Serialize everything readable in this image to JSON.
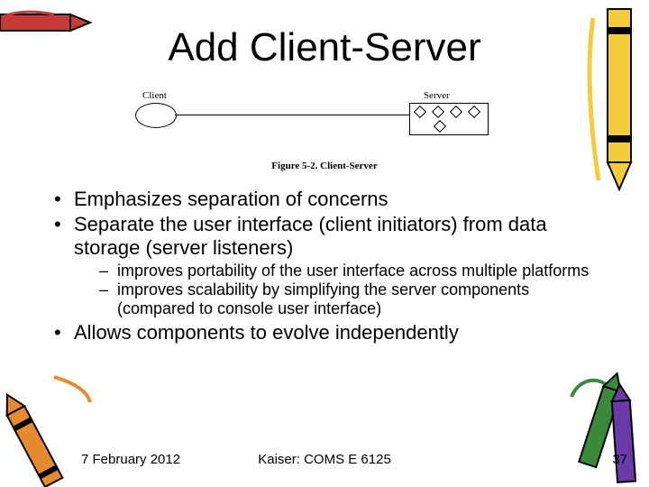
{
  "title": "Add Client-Server",
  "diagram": {
    "client_label": "Client",
    "server_label": "Server",
    "caption": "Figure 5-2. Client-Server"
  },
  "bullets": {
    "b1": "Emphasizes separation of concerns",
    "b2": "Separate the user interface (client initiators) from data storage (server listeners)",
    "b2a": "improves portability of the user interface across multiple platforms",
    "b2b": "improves scalability by simplifying the server components (compared to console user interface)",
    "b3": "Allows components to evolve independently"
  },
  "footer": {
    "date": "7 February 2012",
    "center": "Kaiser: COMS E 6125",
    "page": "37"
  }
}
